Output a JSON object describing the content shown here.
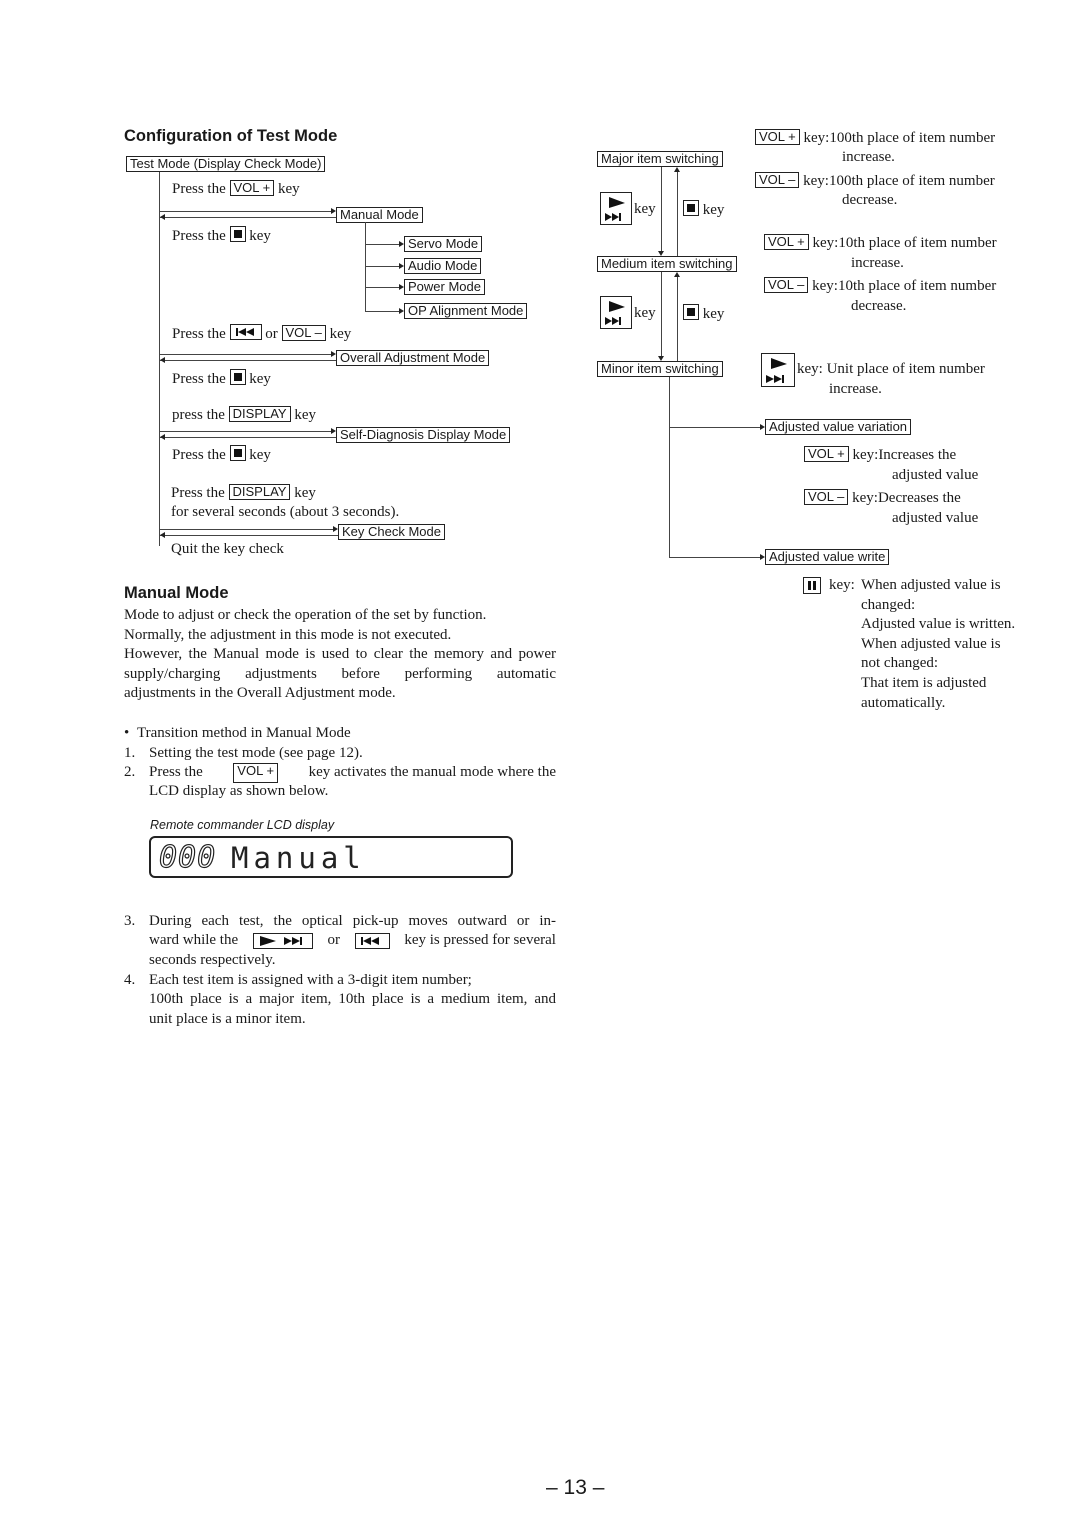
{
  "config": {
    "heading": "Configuration of Test Mode",
    "root_box": "Test Mode (Display Check Mode)",
    "steps": {
      "press_the": "Press the",
      "press_the_lower": "press the",
      "key": "key",
      "or": "or",
      "vol_plus": "VOL +",
      "vol_minus": "VOL –",
      "display": "DISPLAY",
      "several_seconds": "for several seconds (about 3 seconds).",
      "quit": "Quit the key check"
    },
    "modes": {
      "manual": "Manual Mode",
      "servo": "Servo Mode",
      "audio": "Audio Mode",
      "power": "Power Mode",
      "op_alignment": "OP Alignment Mode",
      "overall": "Overall Adjustment Mode",
      "self_diag": "Self-Diagnosis Display Mode",
      "key_check": "Key Check Mode"
    }
  },
  "item_switching": {
    "major": "Major item switching",
    "medium": "Medium item switching",
    "minor": "Minor item switching",
    "key": "key",
    "variation": "Adjusted value variation",
    "write": "Adjusted value write",
    "descriptions": [
      {
        "key": "VOL +",
        "label": "key:",
        "line1": "100th place of item number",
        "line2": "increase."
      },
      {
        "key": "VOL –",
        "label": "key:",
        "line1": "100th place of item number",
        "line2": "decrease."
      },
      {
        "key": "VOL +",
        "label": "key:",
        "line1": "10th place of item number",
        "line2": "increase."
      },
      {
        "key": "VOL –",
        "label": "key:",
        "line1": "10th place of item number",
        "line2": "decrease."
      }
    ],
    "unit_desc": {
      "label": "key:",
      "line1": "Unit place of item number",
      "line2": "increase."
    },
    "var_desc": [
      {
        "key": "VOL +",
        "label": "key:",
        "line1": "Increases the",
        "line2": "adjusted value"
      },
      {
        "key": "VOL –",
        "label": "key:",
        "line1": "Decreases the",
        "line2": "adjusted value"
      }
    ],
    "write_desc": {
      "label": "key:",
      "lines": [
        "When adjusted value is",
        "changed:",
        "Adjusted value is written.",
        "When adjusted value is",
        "not changed:",
        "That item is adjusted",
        "automatically."
      ]
    }
  },
  "manual_mode": {
    "heading": "Manual Mode",
    "para": [
      "Mode to adjust or check the operation of the set by function.",
      "Normally, the adjustment in this mode is not executed.",
      "However, the Manual mode is used to clear the memory and power",
      "supply/charging adjustments before performing automatic",
      "adjustments in the Overall Adjustment mode."
    ],
    "bullet": "Transition method in Manual Mode",
    "items": {
      "n1": "1.",
      "t1": "Setting the test mode (see page 12).",
      "n2": "2.",
      "t2a": "Press the",
      "t2key": "VOL +",
      "t2b": "key activates the manual mode where the",
      "t2c": "LCD display as shown below.",
      "n3": "3.",
      "t3a": "During each test, the optical pick-up moves outward or in-",
      "t3b": "ward while the",
      "t3or": "or",
      "t3c": "key is pressed for several",
      "t3d": "seconds respectively.",
      "n4": "4.",
      "t4a": "Each test item is assigned with a 3-digit item number;",
      "t4b": "100th place is a major item, 10th place is a medium item, and",
      "t4c": "unit place is a minor item."
    },
    "lcd_caption": "Remote commander LCD display",
    "lcd_digits": "000",
    "lcd_text": "Manual"
  },
  "page_number": "– 13 –"
}
